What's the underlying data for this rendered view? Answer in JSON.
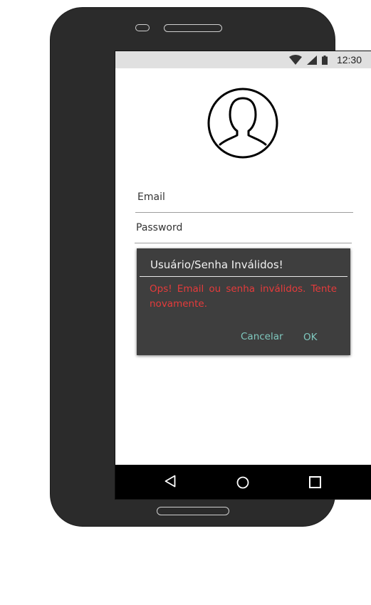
{
  "status_bar": {
    "time": "12:30",
    "icons": [
      "wifi-icon",
      "cell-signal-icon",
      "battery-icon"
    ]
  },
  "login": {
    "avatar_icon": "user-silhouette-icon",
    "email_label": "Email",
    "password_label": "Password"
  },
  "dialog": {
    "title": "Usuário/Senha Inválidos!",
    "message": "Ops! Email ou senha inválidos. Tente novamente.",
    "cancel_label": "Cancelar",
    "ok_label": "OK"
  },
  "nav_bar": {
    "icons": [
      "back-icon",
      "home-icon",
      "recents-icon"
    ]
  },
  "colors": {
    "device_frame": "#2b2b2b",
    "status_bar": "#e0e0e0",
    "dialog_background": "#3e3e3e",
    "dialog_title": "#f2f2f2",
    "dialog_message": "#e53b3b",
    "dialog_buttons": "#7fc8be",
    "nav_bar": "#000000"
  }
}
